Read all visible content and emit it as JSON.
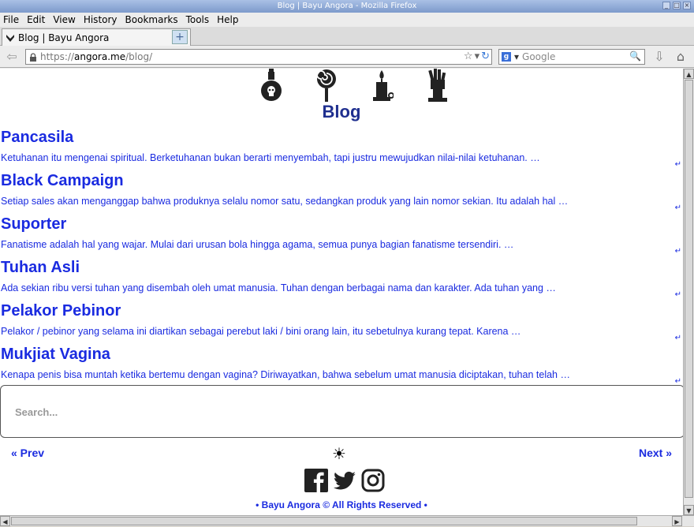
{
  "window": {
    "title": "Blog | Bayu Angora - Mozilla Firefox",
    "controls": [
      "_",
      "□",
      "×"
    ]
  },
  "menu": [
    "File",
    "Edit",
    "View",
    "History",
    "Bookmarks",
    "Tools",
    "Help"
  ],
  "tab": {
    "label": "Blog | Bayu Angora",
    "new_tab": "+"
  },
  "navbar": {
    "back": "⇦",
    "url_scheme": "https://",
    "url_host": "angora.me",
    "url_path": "/blog/",
    "star": "☆",
    "dropdown": "▾",
    "reload": "↻",
    "search_engine": "g",
    "search_placeholder": "Google",
    "search_mag": "🔍",
    "download": "⇩",
    "home": "⌂"
  },
  "page": {
    "title": "Blog",
    "header_icons": [
      "potion-skull-icon",
      "lollipop-icon",
      "candle-icon",
      "zombie-hand-icon"
    ],
    "posts": [
      {
        "title": "Pancasila",
        "excerpt": "Ketuhanan itu mengenai spiritual. Berketuhanan bukan berarti menyembah, tapi justru mewujudkan nilai-nilai ketuhanan. …"
      },
      {
        "title": "Black Campaign",
        "excerpt": "Setiap sales akan menganggap bahwa produknya selalu nomor satu, sedangkan produk yang lain nomor sekian. Itu adalah hal …"
      },
      {
        "title": "Suporter",
        "excerpt": "Fanatisme adalah hal yang wajar. Mulai dari urusan bola hingga agama, semua punya bagian fanatisme tersendiri. …"
      },
      {
        "title": "Tuhan Asli",
        "excerpt": "Ada sekian ribu versi tuhan yang disembah oleh umat manusia. Tuhan dengan berbagai nama dan karakter. Ada tuhan yang …"
      },
      {
        "title": "Pelakor Pebinor",
        "excerpt": "Pelakor / pebinor yang selama ini diartikan sebagai perebut laki / bini orang lain, itu sebetulnya kurang tepat. Karena …"
      },
      {
        "title": "Mukjiat Vagina",
        "excerpt": "Kenapa penis bisa muntah ketika bertemu dengan vagina? Diriwayatkan, bahwa sebelum umat manusia diciptakan, tuhan telah …"
      }
    ],
    "post_arrow": "↵",
    "search_placeholder": "Search...",
    "prev": "« Prev",
    "next": "Next »",
    "theme_toggle": "☀",
    "social": [
      "facebook-icon",
      "twitter-icon",
      "instagram-icon"
    ],
    "footer": "• Bayu Angora © All Rights Reserved •"
  },
  "colors": {
    "link": "#1a2be0",
    "title": "#1f2f8f"
  }
}
